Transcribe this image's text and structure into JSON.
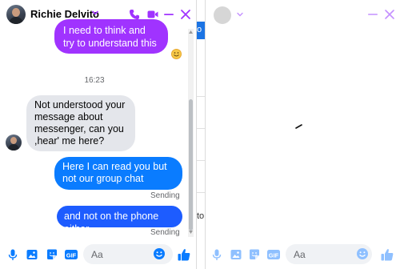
{
  "colors": {
    "accent": "#a033ff",
    "outgoing_blue": "#0a7cff",
    "outgoing_blue_dark": "#1d5cff",
    "incoming_gray": "#e4e6eb",
    "icon_blue": "#0a7cff",
    "icon_purple": "#a033ff"
  },
  "left_chat": {
    "contact_name": "Richie Delvito",
    "header_icons": [
      "chevron-down-icon",
      "phone-icon",
      "video-icon",
      "minimize-icon",
      "close-icon"
    ],
    "messages": {
      "outgoing_purple": "I need to think and try to understand this",
      "timestamp": "16:23",
      "incoming": "Not understood your message about messenger, can you ,hear' me here?",
      "outgoing_1": "Here I can read you but not our group chat",
      "outgoing_1_status": "Sending",
      "outgoing_2": "and not on the phone either",
      "outgoing_2_status": "Sending"
    },
    "composer": {
      "placeholder": "Aa",
      "icons": [
        "microphone-icon",
        "image-icon",
        "sticker-icon",
        "gif-icon",
        "emoji-icon",
        "thumbs-up-icon"
      ],
      "gif_label": "GIF"
    }
  },
  "background_page": {
    "fragment_top": "o",
    "fragment_bottom": "to"
  },
  "right_chat": {
    "contact_name": "",
    "header_icons": [
      "chevron-down-icon",
      "minimize-icon",
      "close-icon"
    ],
    "composer": {
      "placeholder": "Aa",
      "gif_label": "GIF"
    }
  }
}
